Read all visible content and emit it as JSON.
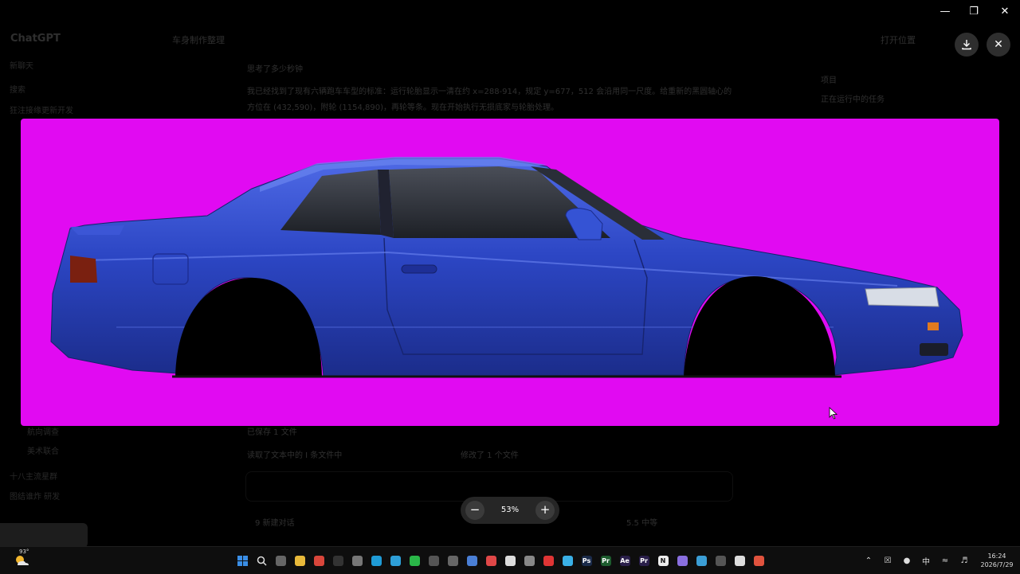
{
  "background_app": {
    "brand": "ChatGPT",
    "sidebar": [
      "新聊天",
      "搜索",
      "狂注接缘更新开发",
      "十八主流星群",
      "图结谁炸 研发"
    ],
    "sidebar_lower": [
      "航向调查",
      "美术联合"
    ],
    "conversation_title": "车身制作整理",
    "open_button": "打开位置",
    "status_line": "思考了多少秒钟",
    "paragraph": "我已经找到了现有六辆跑车车型的标准：运行轮胎显示一清在约 x=288-914，规定 y=677，512 会沿用同一尺度。给重新的黑圆轴心的方位在 (432,590)，附轮 (1154,890)，再轮等条。现在开始执行无损底家与轮胎处理。",
    "right_panel": [
      "项目",
      "正在运行中的任务"
    ],
    "lower_status": [
      "已保存 1 文件",
      "读取了文本中的 I 条文件中",
      "修改了 1 个文件"
    ],
    "input_hint": "9 新建对话",
    "input_meta": "5.5 中等"
  },
  "viewer": {
    "zoom_level": "53%",
    "download_icon": "download-icon",
    "close_icon": "close-icon",
    "backdrop_color": "#e10af2",
    "car_color": "#2c46c4"
  },
  "window_controls": [
    "minimize-icon",
    "restore-icon",
    "close-icon"
  ],
  "taskbar": {
    "weather_temp": "93°",
    "apps": [
      {
        "name": "start",
        "color": "#3a8ee6",
        "glyph": ""
      },
      {
        "name": "search",
        "color": "#444",
        "glyph": ""
      },
      {
        "name": "task-view",
        "color": "#666",
        "glyph": ""
      },
      {
        "name": "file-explorer",
        "color": "#e8b93a",
        "glyph": ""
      },
      {
        "name": "chrome",
        "color": "#d9463b",
        "glyph": ""
      },
      {
        "name": "app-a",
        "color": "#333",
        "glyph": ""
      },
      {
        "name": "app-b",
        "color": "#777",
        "glyph": ""
      },
      {
        "name": "edge",
        "color": "#1f9bd6",
        "glyph": ""
      },
      {
        "name": "app-c",
        "color": "#2e9fd8",
        "glyph": ""
      },
      {
        "name": "wechat",
        "color": "#2ab748",
        "glyph": ""
      },
      {
        "name": "app-d",
        "color": "#555",
        "glyph": ""
      },
      {
        "name": "app-e",
        "color": "#666",
        "glyph": ""
      },
      {
        "name": "app-f",
        "color": "#4a7fd6",
        "glyph": ""
      },
      {
        "name": "app-g",
        "color": "#e04848",
        "glyph": ""
      },
      {
        "name": "app-h",
        "color": "#ddd",
        "glyph": ""
      },
      {
        "name": "app-i",
        "color": "#888",
        "glyph": ""
      },
      {
        "name": "app-j",
        "color": "#e03535",
        "glyph": ""
      },
      {
        "name": "app-k",
        "color": "#3ab0e6",
        "glyph": ""
      },
      {
        "name": "photoshop",
        "color": "#1b2b4a",
        "glyph": "Ps"
      },
      {
        "name": "app-l",
        "color": "#1d5c2e",
        "glyph": "Pr"
      },
      {
        "name": "after-effects",
        "color": "#2a1f4a",
        "glyph": "Ae"
      },
      {
        "name": "premiere",
        "color": "#2a1f4a",
        "glyph": "Pr"
      },
      {
        "name": "notion",
        "color": "#eee",
        "glyph": "N"
      },
      {
        "name": "app-m",
        "color": "#8a6fe0",
        "glyph": ""
      },
      {
        "name": "app-n",
        "color": "#3b9ed6",
        "glyph": ""
      },
      {
        "name": "app-o",
        "color": "#555",
        "glyph": ""
      },
      {
        "name": "chatgpt",
        "color": "#ddd",
        "glyph": ""
      },
      {
        "name": "chrome-2",
        "color": "#e0533e",
        "glyph": ""
      }
    ],
    "tray": {
      "ime": "中",
      "time": "16:24",
      "date": "2026/7/29"
    }
  }
}
